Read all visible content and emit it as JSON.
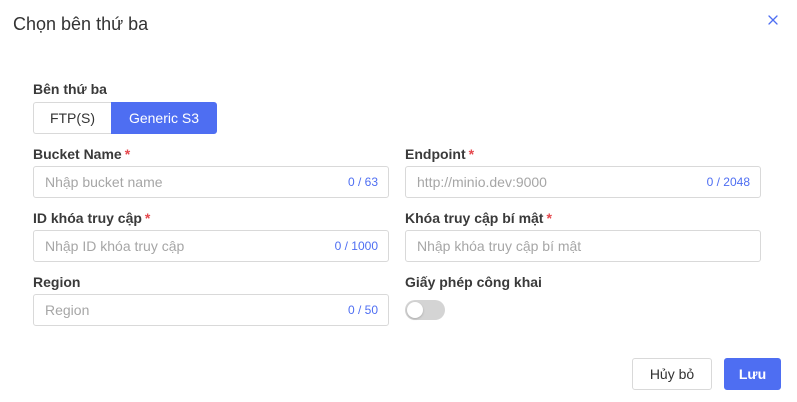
{
  "dialog": {
    "title": "Chọn bên thứ ba"
  },
  "provider": {
    "label": "Bên thứ ba",
    "options": [
      "FTP(S)",
      "Generic S3"
    ],
    "selected": "Generic S3"
  },
  "fields": {
    "bucket": {
      "label": "Bucket Name",
      "required": "*",
      "placeholder": "Nhập bucket name",
      "value": "",
      "counter": "0 / 63"
    },
    "endpoint": {
      "label": "Endpoint",
      "required": "*",
      "placeholder": "http://minio.dev:9000",
      "value": "",
      "counter": "0 / 2048"
    },
    "access_id": {
      "label": "ID khóa truy cập",
      "required": "*",
      "placeholder": "Nhập ID khóa truy cập",
      "value": "",
      "counter": "0 / 1000"
    },
    "secret_key": {
      "label": "Khóa truy cập bí mật",
      "required": "*",
      "placeholder": "Nhập khóa truy cập bí mật",
      "value": ""
    },
    "region": {
      "label": "Region",
      "placeholder": "Region",
      "value": "",
      "counter": "0 / 50"
    }
  },
  "public_license": {
    "label": "Giấy phép công khai",
    "enabled": false
  },
  "actions": {
    "cancel_label": "Hủy bỏ",
    "save_label": "Lưu"
  },
  "colors": {
    "primary": "#4e6ef2",
    "required": "#e5484d",
    "border": "#d9d9d9",
    "toggle_off": "#d4d4d4"
  },
  "icons": {
    "close": "close-icon"
  }
}
